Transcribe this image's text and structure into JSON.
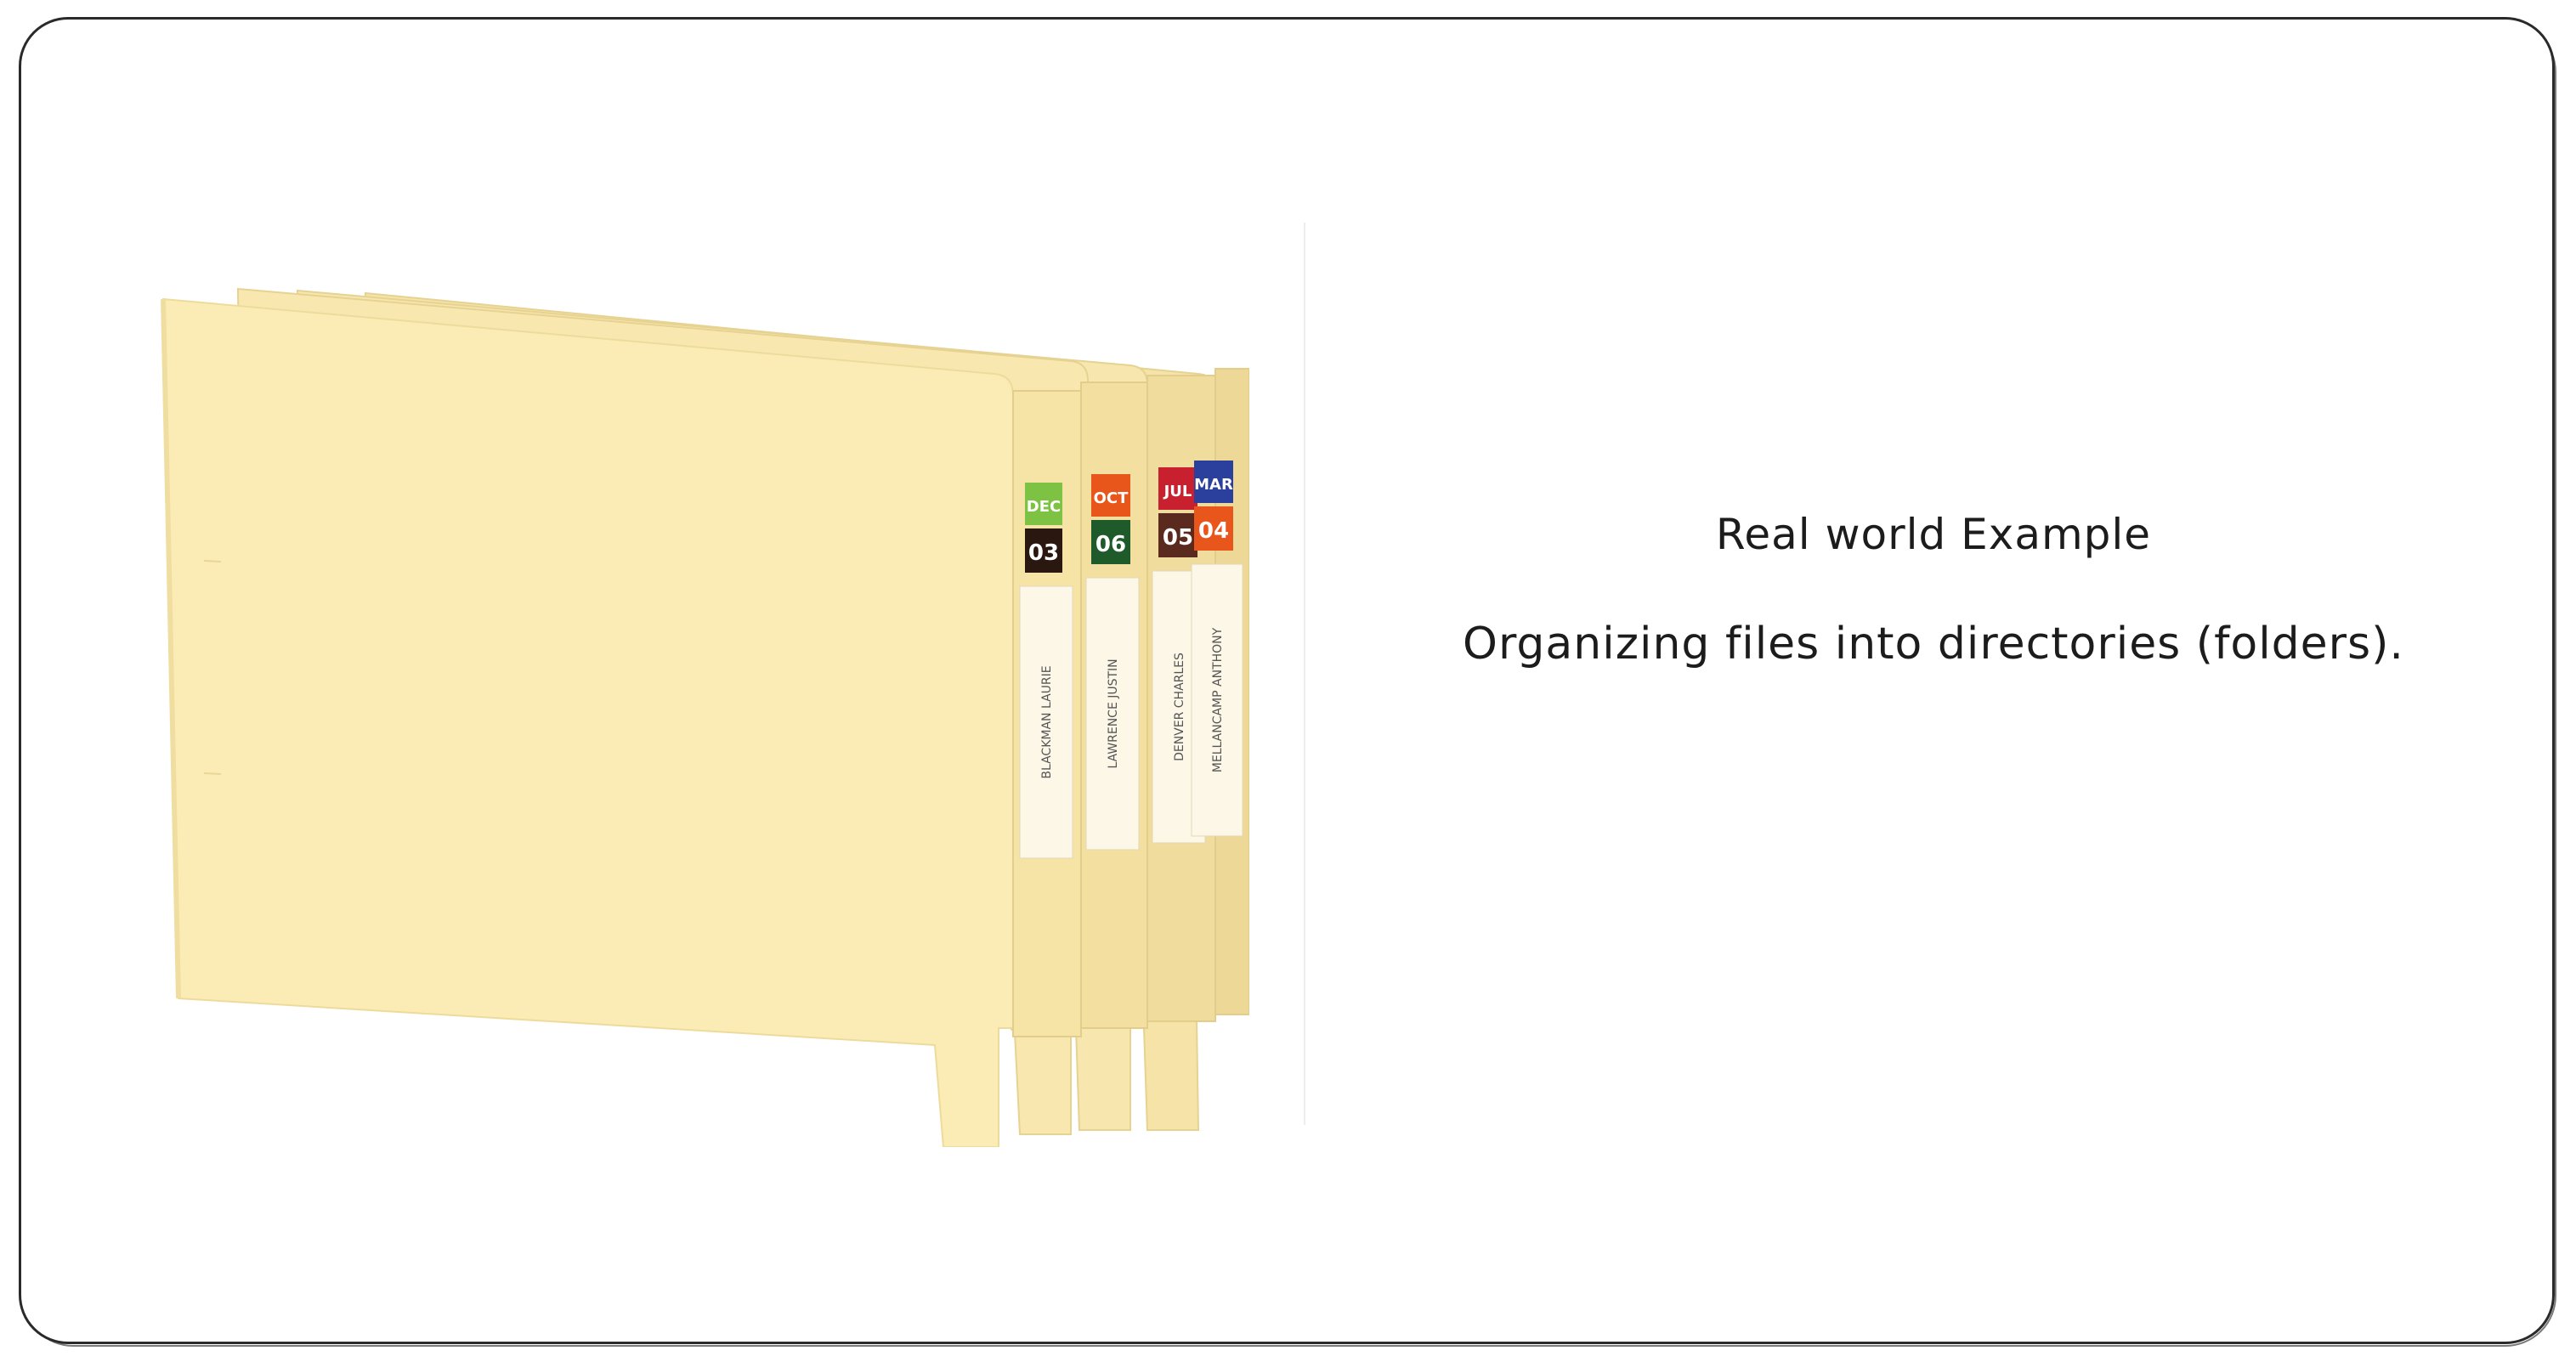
{
  "slide": {
    "title": "Real world Example",
    "description": "Organizing files into directories (folders)."
  },
  "folders": [
    {
      "month": "DEC",
      "day": "03",
      "name": "BLACKMAN LAURIE",
      "month_color": "#7dc242",
      "day_color": "#2a1710"
    },
    {
      "month": "OCT",
      "day": "06",
      "name": "LAWRENCE JUSTIN",
      "month_color": "#e8561c",
      "day_color": "#1f5a2b"
    },
    {
      "month": "JUL",
      "day": "05",
      "name": "DENVER CHARLES",
      "month_color": "#c8202f",
      "day_color": "#5a2a1e"
    },
    {
      "month": "MAR",
      "day": "04",
      "name": "MELLANCAMP ANTHONY",
      "month_color": "#2b3f9c",
      "day_color": "#e8561c"
    }
  ],
  "colors": {
    "folder": "#fbecb6",
    "folder_edge": "#eedb9c",
    "border": "#2a2a2a"
  }
}
